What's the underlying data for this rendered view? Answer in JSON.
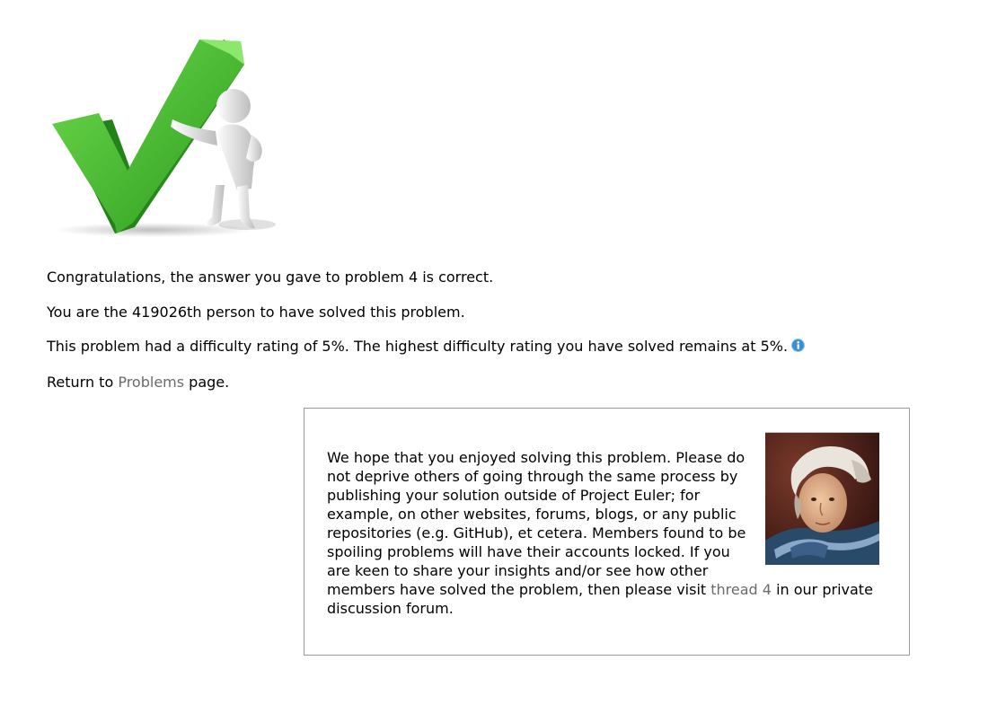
{
  "result": {
    "congrats_before": "Congratulations, the answer you gave to problem 4 is correct.",
    "solver_text": "You are the 419026th person to have solved this problem.",
    "difficulty_text": "This problem had a difficulty rating of 5%. The highest difficulty rating you have solved remains at 5%.",
    "return_prefix": "Return to ",
    "return_link": "Problems",
    "return_suffix": " page."
  },
  "notice": {
    "text_before": "We hope that you enjoyed solving this problem. Please do not deprive others of going through the same process by publishing your solution outside of Project Euler; for example, on other websites, forums, blogs, or any public repositories (e.g. GitHub), et cetera. Members found to be spoiling problems will have their accounts locked. If you are keen to share your insights and/or see how other members have solved the problem, then please visit ",
    "thread_link": "thread 4",
    "text_after": " in our private discussion forum."
  },
  "icons": {
    "check": "green-checkmark-figure-icon",
    "info": "info-icon",
    "portrait": "euler-portrait"
  },
  "colors": {
    "check_green": "#3fb52a",
    "link_gray": "#6b6b6b",
    "info_blue": "#3a8fd0",
    "box_border": "#9a9a9a"
  }
}
